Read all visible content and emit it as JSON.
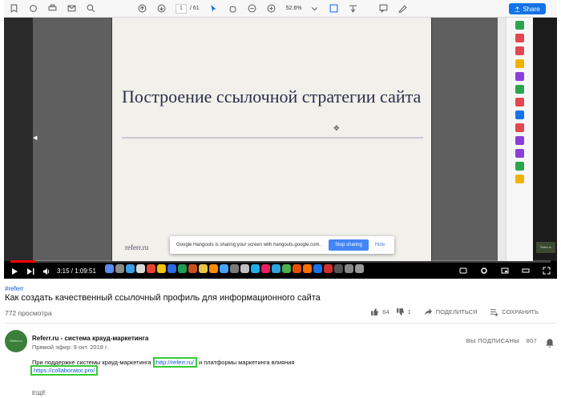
{
  "pdf_toolbar": {
    "page_current": "1",
    "page_total": "/ 61",
    "zoom": "52.6%",
    "share_label": "Share",
    "icons": [
      "bookmark-add-icon",
      "sync-icon",
      "print-icon",
      "mail-icon",
      "search-icon",
      "page-up-icon",
      "page-down-icon",
      "cursor-icon",
      "hand-icon",
      "zoom-out-icon",
      "zoom-in-icon",
      "fit-icon",
      "scroll-icon",
      "comment-icon",
      "sign-icon"
    ]
  },
  "slide": {
    "title": "Построение ссылочной стратегии сайта",
    "footer": "referr.ru"
  },
  "hangouts": {
    "message": "Google Hangouts is sharing your screen with hangouts.google.com.",
    "stop_label": "Stop sharing",
    "hide_label": "Hide"
  },
  "player": {
    "time": "3:15 / 1:09:51",
    "progress": 0.046,
    "thumb_label": "Referr.ru"
  },
  "video": {
    "hashtag": "#referr",
    "title": "Как создать качественный ссылочный профиль для информационного сайта",
    "views": "772 просмотра",
    "likes": "64",
    "dislikes": "1",
    "share_label": "ПОДЕЛИТЬСЯ",
    "save_label": "СОХРАНИТЬ"
  },
  "channel": {
    "avatar_label": "Referr.ru",
    "name": "Referr.ru - система крауд-маркетинга",
    "published": "Прямой эфир: 9 окт. 2018 г.",
    "subscribed_label": "ВЫ ПОДПИСАНЫ",
    "subscribers": "807"
  },
  "description": {
    "line1_before": "При поддержке системы крауд-маркетинга ",
    "link1": "http://referr.ru/",
    "line1_after": " и платформы маркетинга влияния",
    "link2": "https://collaborator.pro/",
    "more_label": "ЕЩЁ"
  },
  "colors": {
    "accent_blue": "#065fd4",
    "share_blue": "#1473e6",
    "progress_red": "#ff0000",
    "highlight_green": "#33cc33"
  }
}
